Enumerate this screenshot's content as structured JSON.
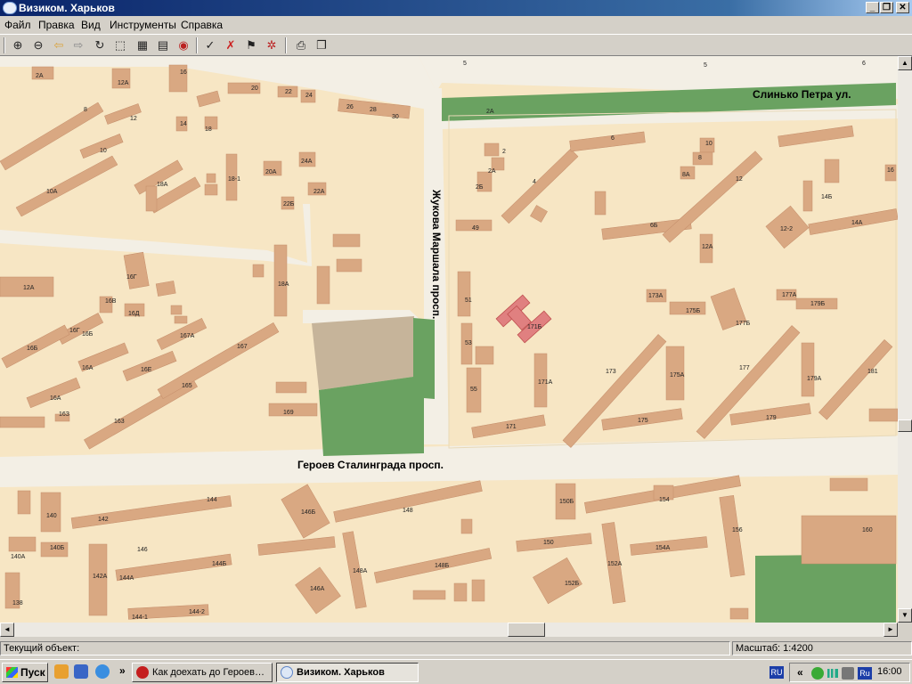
{
  "window": {
    "title": "Визиком. Харьков"
  },
  "window_controls": {
    "minimize": "_",
    "maximize": "❐",
    "close": "✕"
  },
  "menu": [
    "Файл",
    "Правка",
    "Вид",
    "Инструменты",
    "Справка"
  ],
  "toolbar": {
    "icons": [
      "zoom-in-icon",
      "zoom-out-icon",
      "back-icon",
      "forward-icon",
      "refresh-icon",
      "select-icon",
      "measure-icon",
      "grid-icon",
      "find-object-icon",
      "checklist-icon",
      "clear-marks-icon",
      "route-icon",
      "settings-icon",
      "print-icon",
      "copy-icon"
    ]
  },
  "map": {
    "streets": [
      "Слинько Петра ул.",
      "Жукова Маршала просп.",
      "Героев Сталинграда просп."
    ],
    "building_labels": [
      "2А",
      "12А",
      "16",
      "20",
      "22",
      "24",
      "2А",
      "5",
      "5",
      "6",
      "8",
      "12",
      "14",
      "18",
      "26",
      "28",
      "30",
      "10",
      "10А",
      "18А",
      "18-1",
      "20А",
      "24А",
      "22А",
      "22Б",
      "6",
      "2",
      "2А",
      "2Б",
      "4",
      "10",
      "8",
      "8А",
      "12",
      "14Б",
      "14А",
      "12-2",
      "16",
      "49",
      "6Б",
      "12А",
      "12А",
      "16Г",
      "16В",
      "16Д",
      "16Г",
      "16Б",
      "16Б",
      "16А",
      "16Е",
      "16А",
      "16З",
      "167А",
      "167",
      "165",
      "163",
      "18А",
      "169",
      "51",
      "53",
      "55",
      "171Б",
      "171А",
      "171",
      "173А",
      "175Б",
      "177Б",
      "177А",
      "179Б",
      "173",
      "175А",
      "177",
      "179А",
      "181",
      "175",
      "179",
      "140",
      "142",
      "144",
      "146Б",
      "148",
      "150Б",
      "154",
      "140А",
      "140Б",
      "146",
      "142А",
      "144А",
      "144Б",
      "148А",
      "148Б",
      "150",
      "152А",
      "154А",
      "156",
      "160",
      "138",
      "144-1",
      "144-2",
      "146А",
      "152Б"
    ]
  },
  "statusbar": {
    "object_label": "Текущий объект:",
    "scale_label": "Масштаб: 1:4200"
  },
  "taskbar": {
    "start_label": "Пуск",
    "overflow": "»",
    "tasks": [
      {
        "label": "Как доехать до Героев…",
        "icon": "opera-icon"
      },
      {
        "label": "Визиком. Харьков",
        "icon": "vizicom-icon",
        "active": true
      }
    ],
    "tray": {
      "overflow": "«",
      "lang1": "RU",
      "lang2": "Ru",
      "time": "16:00"
    }
  }
}
